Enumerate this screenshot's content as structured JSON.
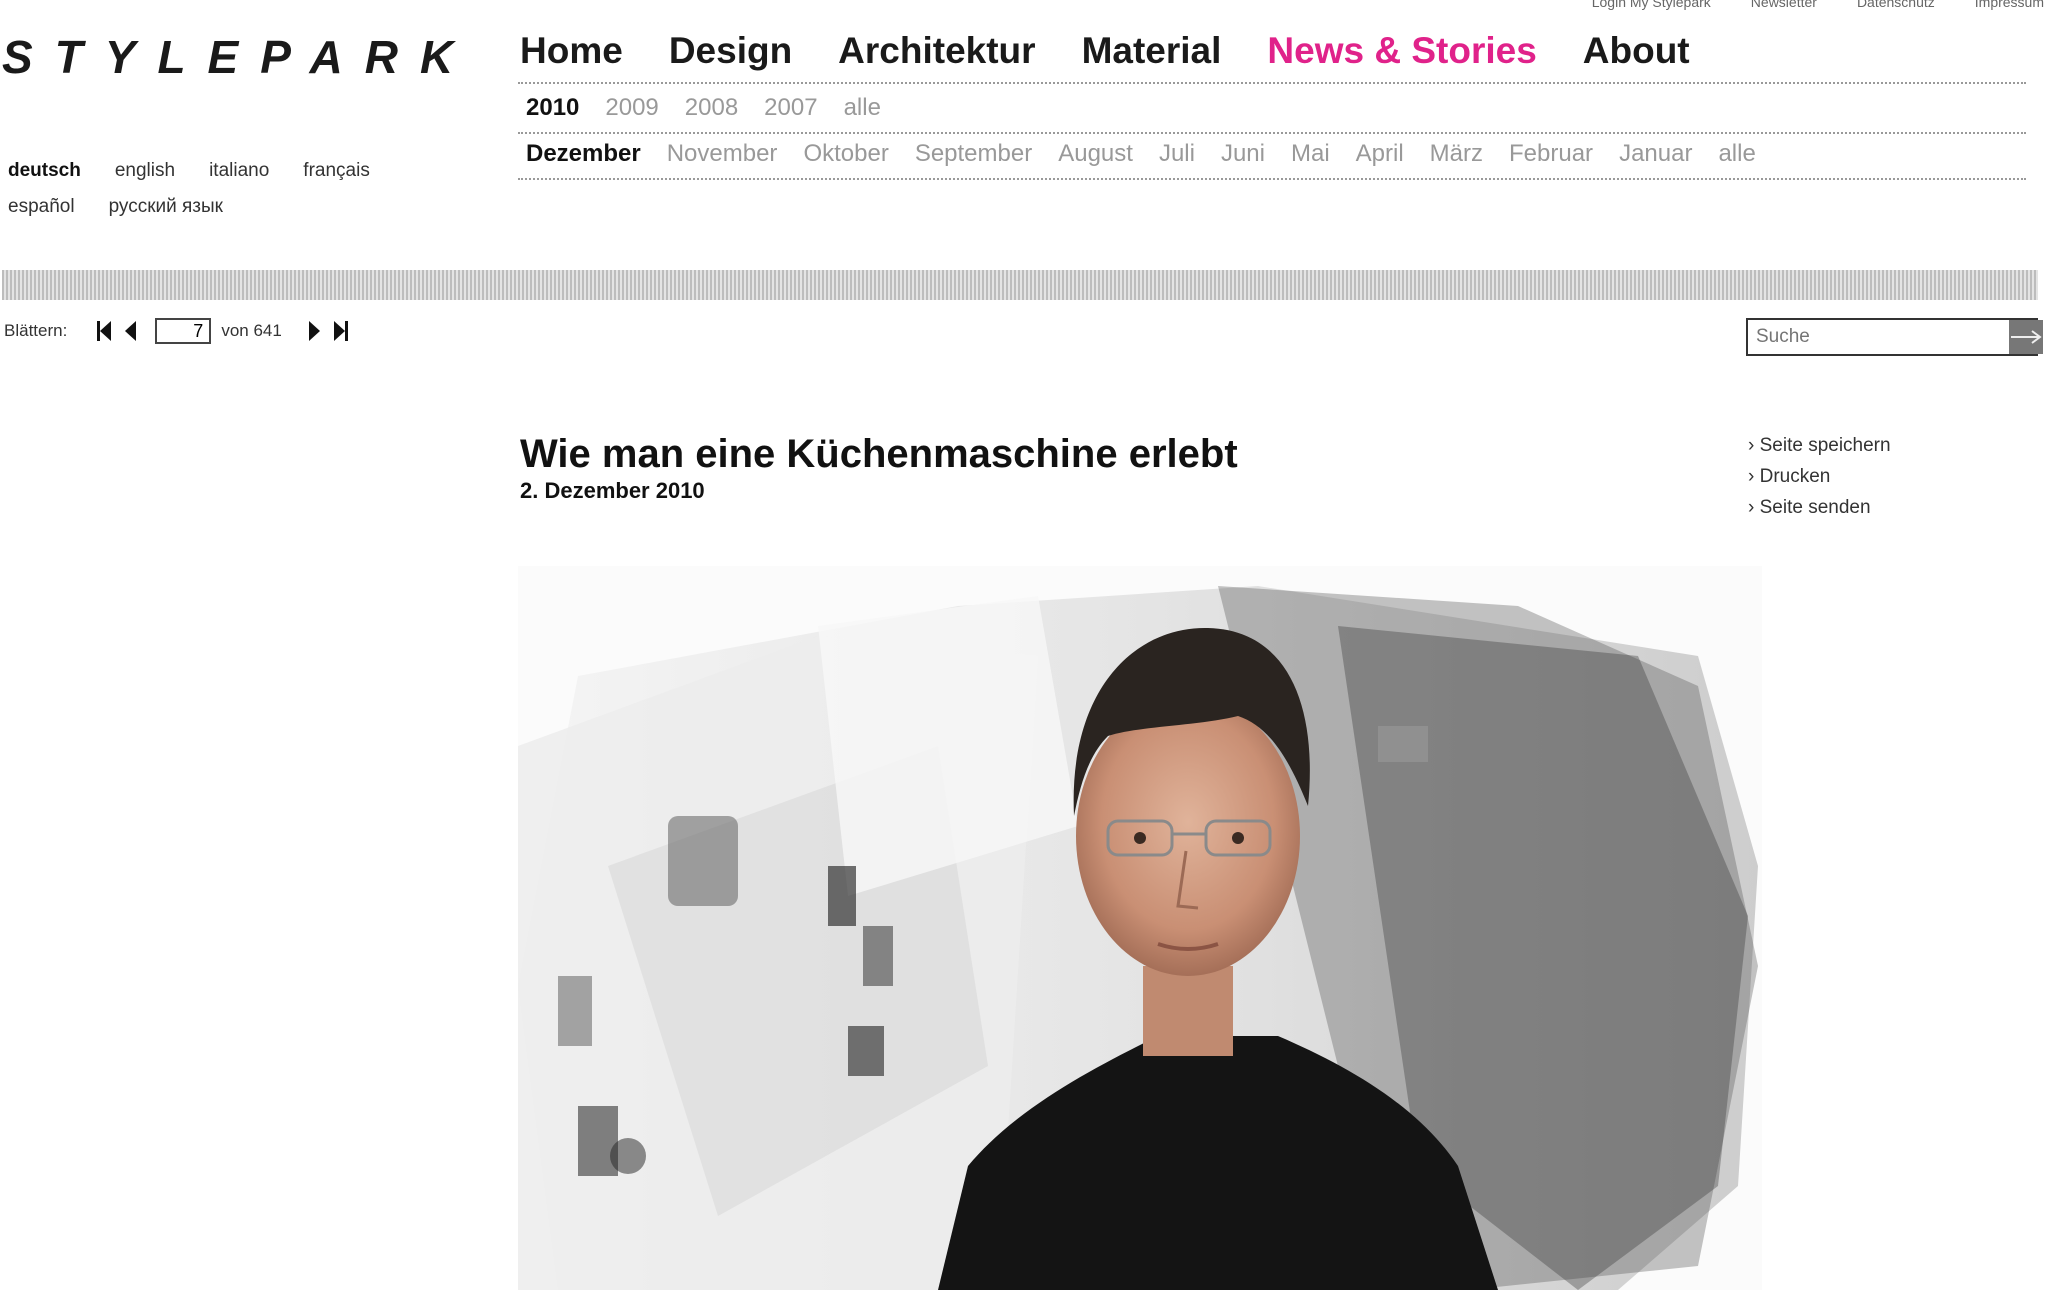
{
  "top_links": [
    "Login My Stylepark",
    "Newsletter",
    "Datenschutz",
    "Impressum"
  ],
  "logo": "STYLEPARK",
  "languages": [
    {
      "label": "deutsch",
      "active": true
    },
    {
      "label": "english",
      "active": false
    },
    {
      "label": "italiano",
      "active": false
    },
    {
      "label": "français",
      "active": false
    },
    {
      "label": "español",
      "active": false
    },
    {
      "label": "русский язык",
      "active": false
    }
  ],
  "nav": [
    {
      "label": "Home",
      "active": false
    },
    {
      "label": "Design",
      "active": false
    },
    {
      "label": "Architektur",
      "active": false
    },
    {
      "label": "Material",
      "active": false
    },
    {
      "label": "News & Stories",
      "active": true
    },
    {
      "label": "About",
      "active": false
    }
  ],
  "years": [
    {
      "label": "2010",
      "active": true
    },
    {
      "label": "2009",
      "active": false
    },
    {
      "label": "2008",
      "active": false
    },
    {
      "label": "2007",
      "active": false
    },
    {
      "label": "alle",
      "active": false
    }
  ],
  "months": [
    {
      "label": "Dezember",
      "active": true
    },
    {
      "label": "November",
      "active": false
    },
    {
      "label": "Oktober",
      "active": false
    },
    {
      "label": "September",
      "active": false
    },
    {
      "label": "August",
      "active": false
    },
    {
      "label": "Juli",
      "active": false
    },
    {
      "label": "Juni",
      "active": false
    },
    {
      "label": "Mai",
      "active": false
    },
    {
      "label": "April",
      "active": false
    },
    {
      "label": "März",
      "active": false
    },
    {
      "label": "Februar",
      "active": false
    },
    {
      "label": "Januar",
      "active": false
    },
    {
      "label": "alle",
      "active": false
    }
  ],
  "pager": {
    "label": "Blättern:",
    "current": "7",
    "total_text": "von 641"
  },
  "search": {
    "placeholder": "Suche"
  },
  "article": {
    "title": "Wie man eine Küchenmaschine erlebt",
    "date": "2. Dezember 2010"
  },
  "actions": [
    "Seite speichern",
    "Drucken",
    "Seite senden"
  ],
  "colors": {
    "accent": "#e0228a"
  }
}
